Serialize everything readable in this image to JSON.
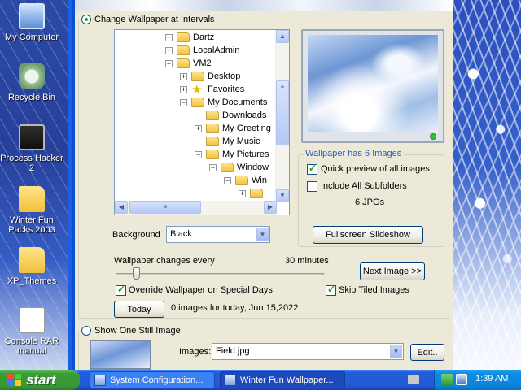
{
  "desktop": {
    "icons": [
      {
        "label": "My Computer",
        "icon": "my-computer-icon"
      },
      {
        "label": "Recycle Bin",
        "icon": "recycle-bin-icon"
      },
      {
        "label": "Process Hacker 2",
        "icon": "process-hacker-icon"
      },
      {
        "label": "Winter Fun Packs 2003",
        "icon": "folder-icon"
      },
      {
        "label": "XP_Themes",
        "icon": "folder-icon"
      },
      {
        "label": "Console RAR manual",
        "icon": "document-icon"
      }
    ]
  },
  "window": {
    "interval_option": "Change Wallpaper at Intervals",
    "tree": {
      "items": [
        {
          "label": "Dartz",
          "box": "+"
        },
        {
          "label": "LocalAdmin",
          "box": "+"
        },
        {
          "label": "VM2",
          "box": "−"
        },
        {
          "label": "Desktop",
          "box": "+"
        },
        {
          "label": "Favorites",
          "box": "+"
        },
        {
          "label": "My Documents",
          "box": "−"
        },
        {
          "label": "Downloads",
          "box": ""
        },
        {
          "label": "My Greeting",
          "box": "+"
        },
        {
          "label": "My Music",
          "box": ""
        },
        {
          "label": "My Pictures",
          "box": "−"
        },
        {
          "label": "Window",
          "box": "−"
        },
        {
          "label": "Win",
          "box": "−"
        },
        {
          "label": "",
          "box": "+"
        }
      ]
    },
    "preview": {
      "heading": "Wallpaper has 6 Images",
      "quick_preview_label": "Quick preview of all images",
      "include_subfolders_label": "Include All Subfolders",
      "count_text": "6 JPGs",
      "slideshow_button": "Fullscreen Slideshow"
    },
    "background": {
      "label": "Background",
      "value": "Black"
    },
    "interval": {
      "label": "Wallpaper changes every",
      "value_text": "30 minutes",
      "next_button": "Next Image >>"
    },
    "override_label": "Override Wallpaper on Special Days",
    "skip_tiled_label": "Skip Tiled Images",
    "today_button": "Today",
    "today_status": "0 images for today, Jun 15,2022",
    "still_option": "Show One Still Image",
    "images": {
      "label": "Images:",
      "value": "Field.jpg",
      "edit_button": "Edit.."
    }
  },
  "taskbar": {
    "start_label": "start",
    "tasks": [
      {
        "label": "System Configuration..."
      },
      {
        "label": "Winter Fun Wallpaper..."
      }
    ],
    "clock": "1:39 AM"
  }
}
